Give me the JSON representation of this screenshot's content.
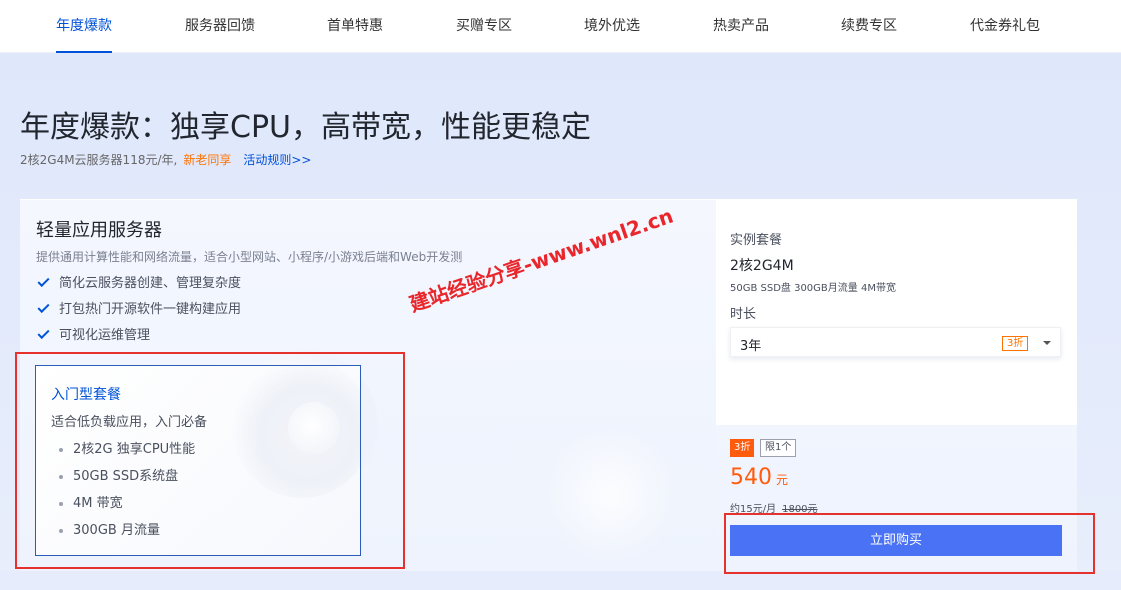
{
  "tabs": [
    {
      "label": "年度爆款",
      "active": true
    },
    {
      "label": "服务器回馈",
      "active": false
    },
    {
      "label": "首单特惠",
      "active": false
    },
    {
      "label": "买赠专区",
      "active": false
    },
    {
      "label": "境外优选",
      "active": false
    },
    {
      "label": "热卖产品",
      "active": false
    },
    {
      "label": "续费专区",
      "active": false
    },
    {
      "label": "代金券礼包",
      "active": false
    }
  ],
  "hero": {
    "title": "年度爆款：独享CPU，高带宽，性能更稳定",
    "subtitle": "2核2G4M云服务器118元/年,",
    "new_user": "新老同享",
    "rules_link": "活动规则>>"
  },
  "product": {
    "title": "轻量应用服务器",
    "description": "提供通用计算性能和网络流量，适合小型网站、小程序/小游戏后端和Web开发测",
    "features": [
      "简化云服务器创建、管理复杂度",
      "打包热门开源软件一键构建应用",
      "可视化运维管理"
    ]
  },
  "package": {
    "title": "入门型套餐",
    "subtitle": "适合低负载应用，入门必备",
    "items": [
      "2核2G 独享CPU性能",
      "50GB SSD系统盘",
      "4M 带宽",
      "300GB 月流量"
    ]
  },
  "config": {
    "instance_label": "实例套餐",
    "spec": "2核2G4M",
    "spec_detail": "50GB SSD盘 300GB月流量 4M带宽",
    "duration_label": "时长",
    "duration_value": "3年",
    "duration_discount": "3折"
  },
  "pricing": {
    "discount_badge": "3折",
    "limit_badge": "限1个",
    "price": "540",
    "currency": "元",
    "monthly": "约15元/月",
    "original": "1800元",
    "buy_label": "立即购买"
  },
  "watermark": "建站经验分享-www.wnl2.cn",
  "colors": {
    "brand_blue": "#0052d9",
    "accent_orange": "#ff5b0d",
    "button_blue": "#4a72f5",
    "highlight_red": "#e5322d"
  }
}
